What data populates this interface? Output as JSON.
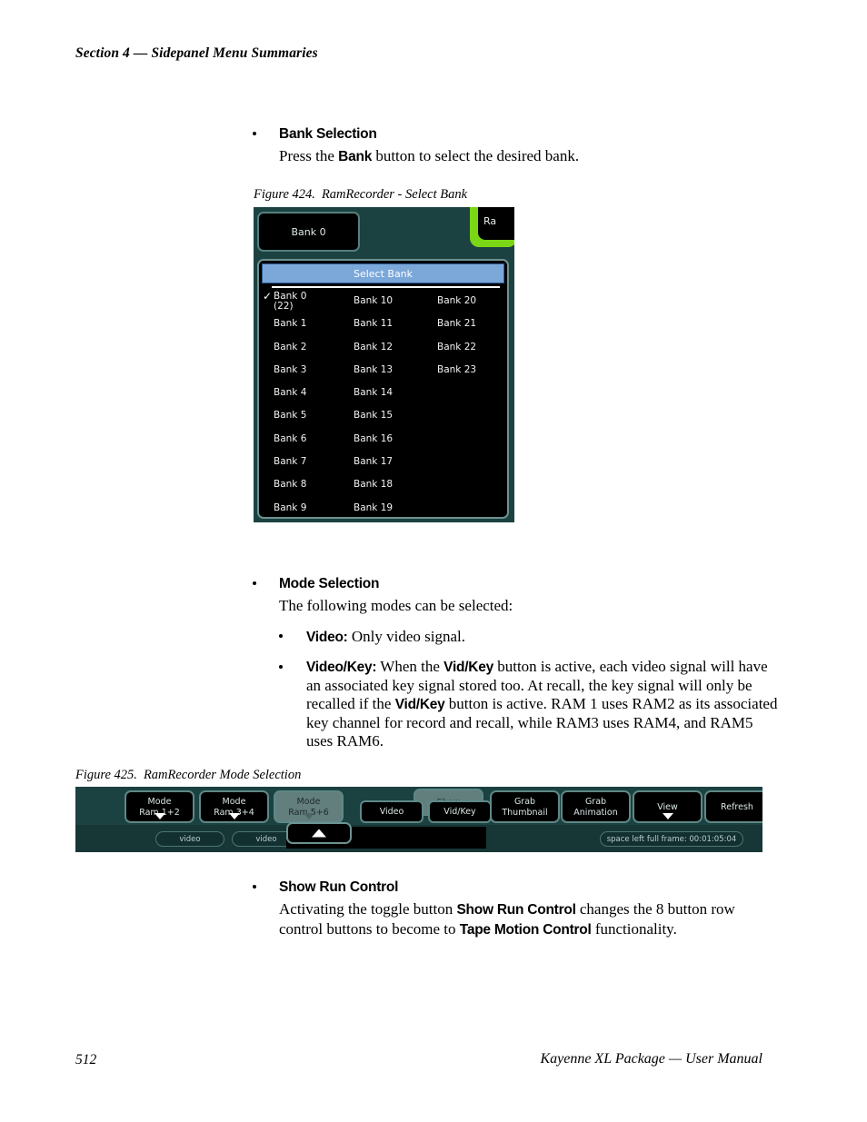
{
  "page": {
    "running_head": "Section 4 — Sidepanel Menu Summaries",
    "footer_page_number": "512",
    "footer_right": "Kayenne XL Package  —  User Manual"
  },
  "sections": {
    "bank_selection": {
      "heading": "Bank Selection",
      "body_prefix": "Press the ",
      "body_bold": "Bank",
      "body_suffix": " button to select the desired bank."
    },
    "mode_selection": {
      "heading": "Mode Selection",
      "intro": "The following modes can be selected:",
      "items": [
        {
          "bold": "Video:",
          "text": " Only video signal."
        },
        {
          "bold": "Video/Key:",
          "text_1": " When the ",
          "bold_2": "Vid/Key",
          "text_2": " button is active, each video signal will have an associated key signal stored too. At recall, the key signal will only be recalled if the ",
          "bold_3": "Vid/Key",
          "text_3": " button is active. RAM 1 uses RAM2 as its associated key channel for record and recall, while RAM3 uses RAM4, and RAM5 uses RAM6."
        }
      ]
    },
    "show_run_control": {
      "heading": "Show Run Control",
      "text_1": "Activating the toggle button ",
      "bold_1": "Show Run Control",
      "text_2": " changes the 8 button row control buttons to become to ",
      "bold_2": "Tape Motion Control",
      "text_3": " functionality."
    }
  },
  "figures": {
    "fig424": {
      "number": "Figure 424.",
      "title": "RamRecorder - Select Bank",
      "bank_button_label": "Bank 0",
      "green_tab_label": "Ra",
      "popup_title": "Select Bank",
      "selected_index": 0,
      "check_glyph": "✓",
      "columns": [
        [
          {
            "label": "Bank  0",
            "sub": "(22)",
            "checked": true
          },
          {
            "label": "Bank  1"
          },
          {
            "label": "Bank  2"
          },
          {
            "label": "Bank  3"
          },
          {
            "label": "Bank  4"
          },
          {
            "label": "Bank  5"
          },
          {
            "label": "Bank  6"
          },
          {
            "label": "Bank  7"
          },
          {
            "label": "Bank  8"
          },
          {
            "label": "Bank  9"
          }
        ],
        [
          {
            "label": "Bank 10"
          },
          {
            "label": "Bank 11"
          },
          {
            "label": "Bank 12"
          },
          {
            "label": "Bank 13"
          },
          {
            "label": "Bank 14"
          },
          {
            "label": "Bank 15"
          },
          {
            "label": "Bank 16"
          },
          {
            "label": "Bank 17"
          },
          {
            "label": "Bank 18"
          },
          {
            "label": "Bank 19"
          }
        ],
        [
          {
            "label": "Bank 20"
          },
          {
            "label": "Bank 21"
          },
          {
            "label": "Bank 22"
          },
          {
            "label": "Bank 23"
          }
        ]
      ]
    },
    "fig425": {
      "number": "Figure 425.",
      "title": "RamRecorder Mode Selection",
      "toolbar_buttons": [
        {
          "line1": "Mode",
          "line2": "Ram 1+2",
          "arrow": "down",
          "state": "normal"
        },
        {
          "line1": "Mode",
          "line2": "Ram 3+4",
          "arrow": "down",
          "state": "normal"
        },
        {
          "line1": "Mode",
          "line2": "Ram 5+6",
          "arrow": "down",
          "state": "pressed"
        },
        {
          "line1": "Show",
          "line2": "",
          "arrow": "none",
          "state": "pressed"
        },
        {
          "line1": "Grab",
          "line2": "Thumbnail",
          "arrow": "none",
          "state": "normal"
        },
        {
          "line1": "Grab",
          "line2": "Animation",
          "arrow": "none",
          "state": "normal"
        },
        {
          "line1": "View",
          "line2": "",
          "arrow": "down",
          "state": "normal"
        },
        {
          "line1": "Refresh",
          "line2": "",
          "arrow": "none",
          "state": "normal"
        }
      ],
      "popup_options": [
        {
          "label": "Video"
        },
        {
          "label": "Vid/Key"
        }
      ],
      "slot_labels": [
        {
          "label": "video"
        },
        {
          "label": "video"
        }
      ],
      "status_label": "space left full frame: 00:01:05:04"
    }
  }
}
